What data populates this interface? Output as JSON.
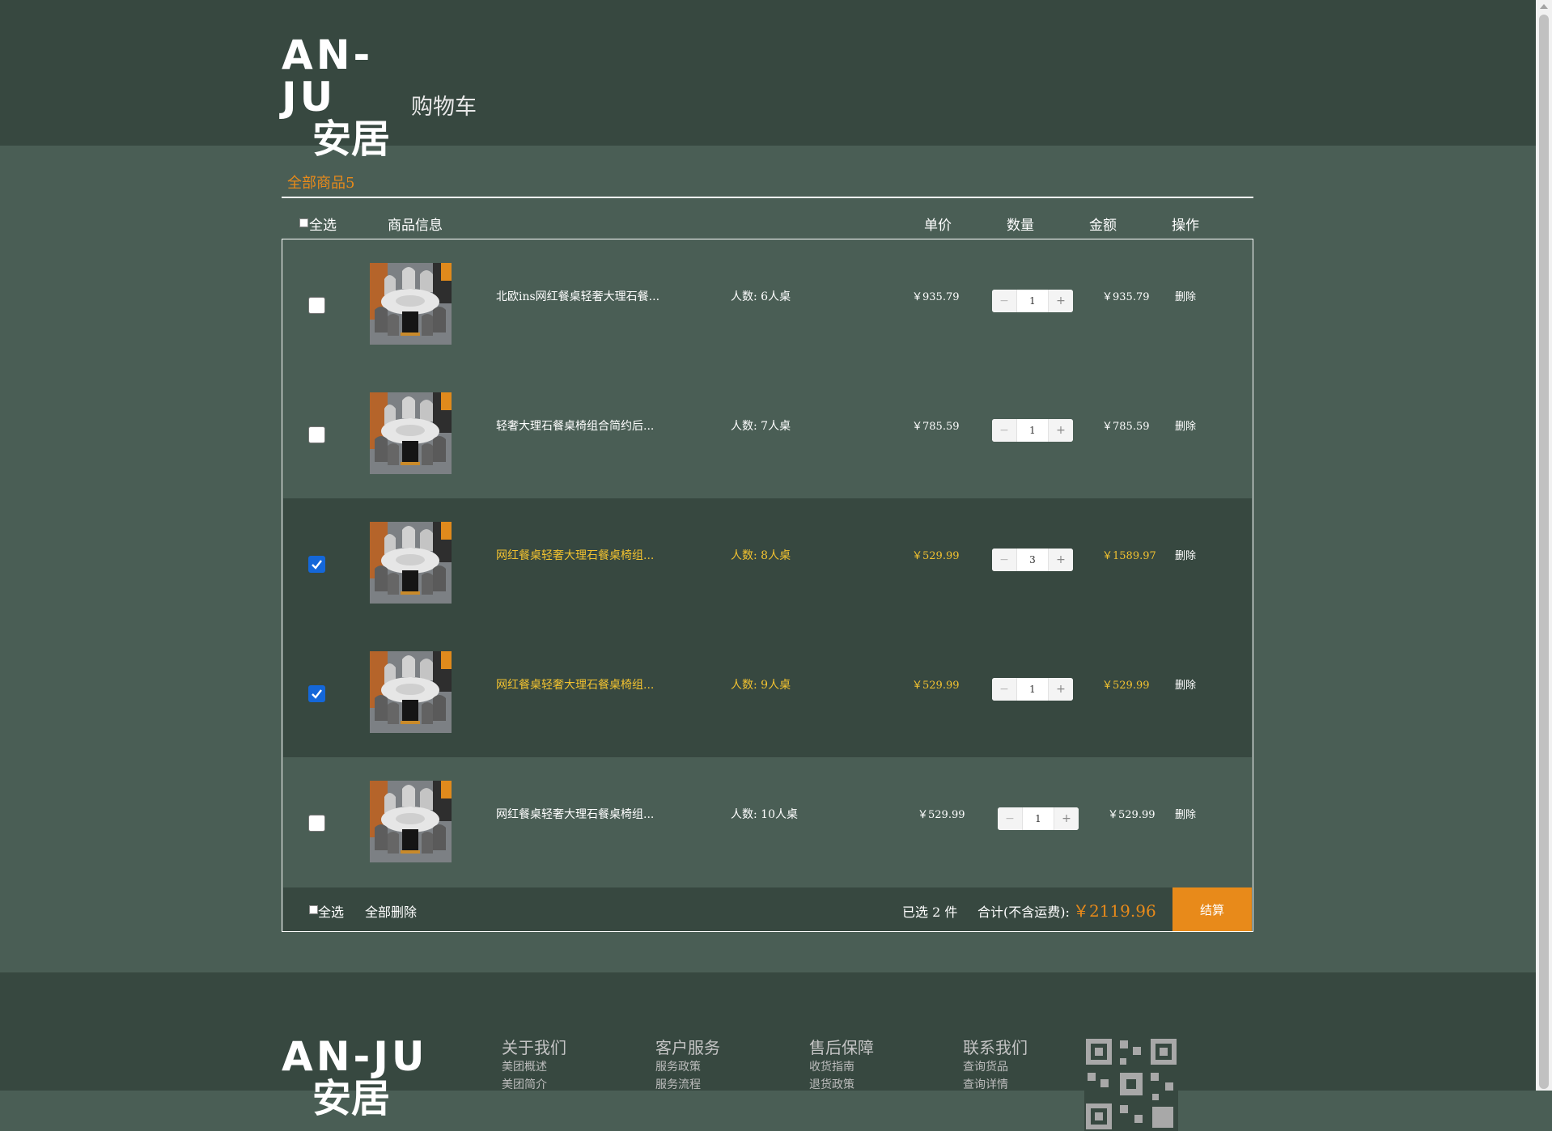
{
  "header": {
    "logo_en": "AN-JU",
    "logo_cn": "安居",
    "page_title": "购物车"
  },
  "tabs": {
    "all_items": "全部商品5"
  },
  "columns": {
    "select_all": "全选",
    "product_info": "商品信息",
    "unit_price": "单价",
    "quantity": "数量",
    "amount": "金额",
    "action": "操作"
  },
  "items": [
    {
      "name": "北欧ins网红餐桌轻奢大理石餐...",
      "spec": "人数: 6人桌",
      "price": "￥935.79",
      "qty": "1",
      "subtotal": "￥935.79",
      "delete": "删除",
      "checked": false
    },
    {
      "name": "轻奢大理石餐桌椅组合简约后...",
      "spec": "人数: 7人桌",
      "price": "￥785.59",
      "qty": "1",
      "subtotal": "￥785.59",
      "delete": "删除",
      "checked": false
    },
    {
      "name": "网红餐桌轻奢大理石餐桌椅组...",
      "spec": "人数: 8人桌",
      "price": "￥529.99",
      "qty": "3",
      "subtotal": "￥1589.97",
      "delete": "删除",
      "checked": true
    },
    {
      "name": "网红餐桌轻奢大理石餐桌椅组...",
      "spec": "人数: 9人桌",
      "price": "￥529.99",
      "qty": "1",
      "subtotal": "￥529.99",
      "delete": "删除",
      "checked": true
    },
    {
      "name": "网红餐桌轻奢大理石餐桌椅组...",
      "spec": "人数: 10人桌",
      "price": "￥529.99",
      "qty": "1",
      "subtotal": "￥529.99",
      "delete": "删除",
      "checked": false
    }
  ],
  "stepper": {
    "minus": "−",
    "plus": "+"
  },
  "cart_footer": {
    "select_all": "全选",
    "delete_all": "全部删除",
    "selected_count": "已选 2 件",
    "total_label": "合计(不含运费):",
    "total_value": "￥2119.96",
    "checkout": "结算"
  },
  "footer": {
    "logo_en": "AN-JU",
    "logo_cn": "安居",
    "columns": [
      {
        "title": "关于我们",
        "links": [
          "美团概述",
          "美团简介"
        ]
      },
      {
        "title": "客户服务",
        "links": [
          "服务政策",
          "服务流程"
        ]
      },
      {
        "title": "售后保障",
        "links": [
          "收货指南",
          "退货政策"
        ]
      },
      {
        "title": "联系我们",
        "links": [
          "查询货品",
          "查询详情"
        ]
      }
    ],
    "qr_icon": "qr-code-icon"
  },
  "colors": {
    "header_bg": "#374840",
    "page_bg": "#4a5e55",
    "accent_orange": "#e88a1a",
    "selected_text": "#f2c230",
    "checkbox_checked": "#1467d9"
  }
}
